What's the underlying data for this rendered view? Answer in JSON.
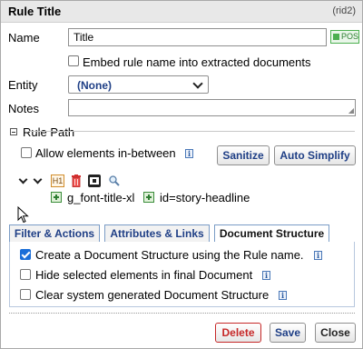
{
  "dialog": {
    "title": "Rule Title",
    "rule_id": "(rid2)"
  },
  "form": {
    "name_label": "Name",
    "name_value": "Title",
    "pos_badge": "POS",
    "embed_label": "Embed rule name into extracted documents",
    "embed_checked": false,
    "entity_label": "Entity",
    "entity_value": "(None)",
    "notes_label": "Notes",
    "notes_value": ""
  },
  "rule_path": {
    "header": "Rule Path",
    "allow_between_label": "Allow elements in-between",
    "allow_between_checked": false,
    "sanitize_label": "Sanitize",
    "auto_simplify_label": "Auto Simplify",
    "element_tag": "H1",
    "class_label": "g_font-title-xl",
    "id_label": "id=story-headline"
  },
  "tabs": [
    {
      "label": "Filter & Actions",
      "active": false
    },
    {
      "label": "Attributes & Links",
      "active": false
    },
    {
      "label": "Document Structure",
      "active": true
    }
  ],
  "document_structure": {
    "options": [
      {
        "label": "Create a Document Structure using the Rule name.",
        "checked": true
      },
      {
        "label": "Hide selected elements in final Document",
        "checked": false
      },
      {
        "label": "Clear system generated Document Structure",
        "checked": false
      }
    ]
  },
  "footer": {
    "delete_label": "Delete",
    "save_label": "Save",
    "close_label": "Close"
  },
  "colors": {
    "link_blue": "#1f3f86",
    "delete_red": "#c62828",
    "checkbox_blue": "#1a6ed8"
  }
}
